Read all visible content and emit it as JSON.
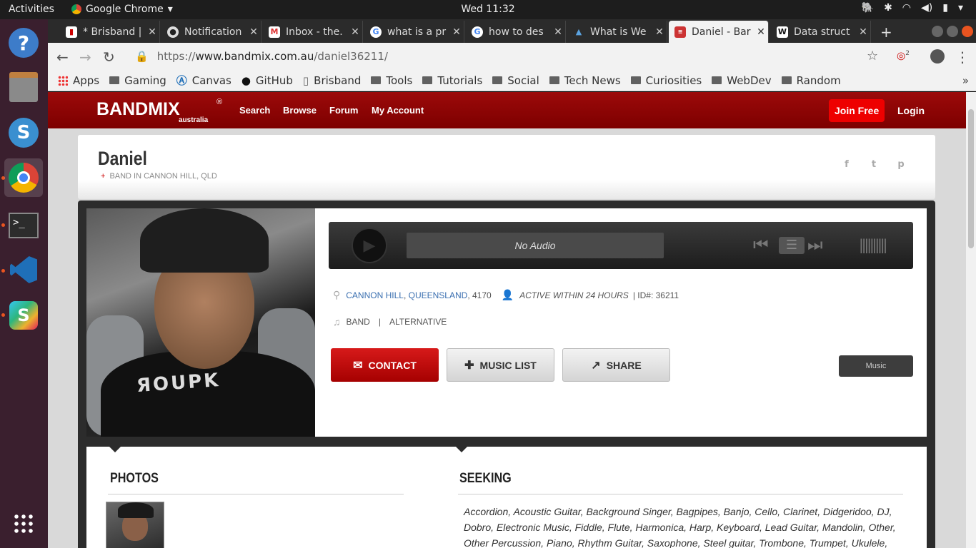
{
  "system": {
    "activities": "Activities",
    "app_name": "Google Chrome",
    "clock": "Wed 11:32"
  },
  "tabs": [
    {
      "title": "* Brisband |",
      "icon": "trello-icon"
    },
    {
      "title": "Notification",
      "icon": "github-icon"
    },
    {
      "title": "Inbox - the.",
      "icon": "gmail-icon"
    },
    {
      "title": "what is a pr",
      "icon": "google-icon"
    },
    {
      "title": "how to des",
      "icon": "google-icon"
    },
    {
      "title": "What is We",
      "icon": "arch-icon"
    },
    {
      "title": "Daniel - Bar",
      "icon": "bandmix-icon"
    },
    {
      "title": "Data struct",
      "icon": "wikipedia-icon"
    }
  ],
  "omnibox": {
    "scheme": "https://",
    "host": "www.bandmix.com.au",
    "path": "/daniel36211/"
  },
  "extension_badge": "2",
  "bookmarks": [
    "Apps",
    "Gaming",
    "Canvas",
    "GitHub",
    "Brisband",
    "Tools",
    "Tutorials",
    "Social",
    "Tech News",
    "Curiosities",
    "WebDev",
    "Random"
  ],
  "site": {
    "logo": "BANDMIX",
    "logo_sub": "australia",
    "logo_reg": "®",
    "nav": [
      "Search",
      "Browse",
      "Forum",
      "My Account"
    ],
    "join": "Join Free",
    "login": "Login"
  },
  "profile": {
    "name": "Daniel",
    "subtitle": "BAND IN CANNON HILL, QLD",
    "shirt_text": "ЯOUPK",
    "player_status": "No Audio",
    "suburb": "CANNON HILL",
    "state": "QUEENSLAND",
    "postcode": ", 4170",
    "activity": "ACTIVE WITHIN 24 HOURS",
    "id_label": "|  ID#: 36211",
    "type": "BAND",
    "genre": "ALTERNATIVE",
    "contact": "CONTACT",
    "music_list": "MUSIC LIST",
    "share": "SHARE",
    "music_tab": "Music"
  },
  "sections": {
    "photos": "PHOTOS",
    "seeking": "SEEKING",
    "seeking_text": "Accordion, Acoustic Guitar, Background Singer, Bagpipes, Banjo, Cello, Clarinet, Didgeridoo, DJ, Dobro, Electronic Music, Fiddle, Flute, Harmonica, Harp, Keyboard, Lead Guitar, Mandolin, Other, Other Percussion, Piano, Rhythm Guitar, Saxophone, Steel guitar, Trombone, Trumpet, Ukulele,"
  }
}
